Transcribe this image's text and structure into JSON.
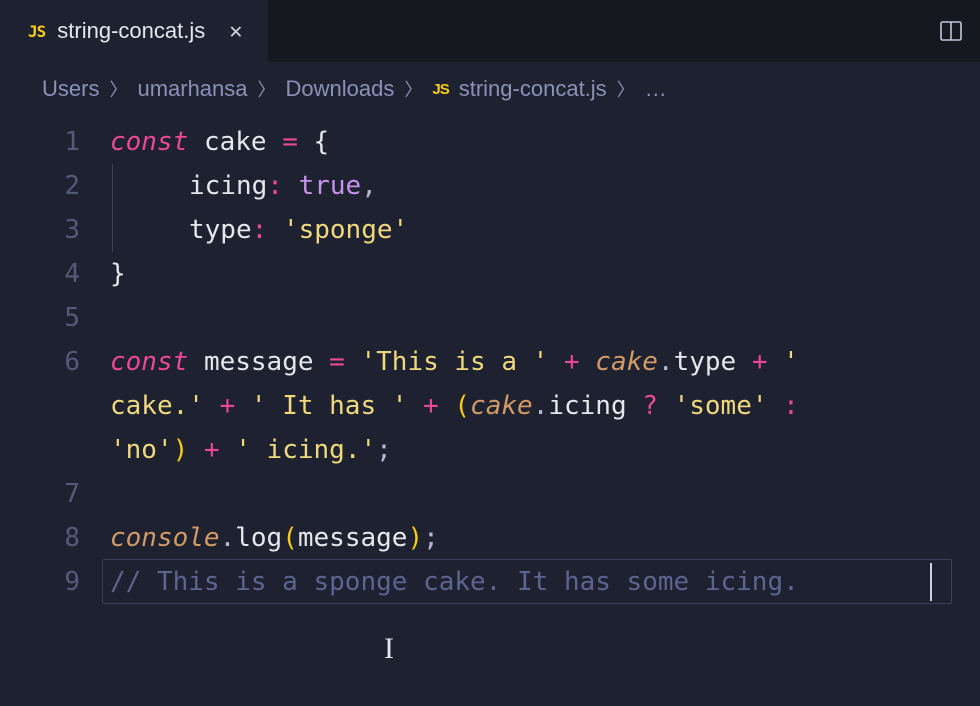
{
  "tab": {
    "lang_badge": "JS",
    "title": "string-concat.js"
  },
  "breadcrumb": {
    "segments": [
      "Users",
      "umarhansa",
      "Downloads"
    ],
    "file_badge": "JS",
    "file": "string-concat.js",
    "ellipsis": "…"
  },
  "gutter": [
    "1",
    "2",
    "3",
    "4",
    "5",
    "6",
    "7",
    "8",
    "9"
  ],
  "code": {
    "l1": {
      "kw": "const",
      "sp1": " ",
      "id": "cake",
      "sp2": " ",
      "eq": "=",
      "sp3": " ",
      "brace": "{"
    },
    "l2": {
      "prop": "icing",
      "colon": ":",
      "sp": " ",
      "val": "true",
      "comma": ","
    },
    "l3": {
      "prop": "type",
      "colon": ":",
      "sp": " ",
      "val": "'sponge'"
    },
    "l4": {
      "brace": "}"
    },
    "l6a": {
      "kw": "const",
      "sp1": " ",
      "id": "message",
      "sp2": " ",
      "eq": "=",
      "sp3": " ",
      "s1": "'This is a '",
      "sp4": " ",
      "plus1": "+",
      "sp5": " ",
      "obj1": "cake",
      "dot1": ".",
      "prop1": "type",
      "sp6": " ",
      "plus2": "+",
      "sp7": " ",
      "s2": "' "
    },
    "l6b": {
      "s3": "cake.'",
      "sp1": " ",
      "plus1": "+",
      "sp2": " ",
      "s4": "' It has '",
      "sp3": " ",
      "plus2": "+",
      "sp4": " ",
      "lp": "(",
      "obj": "cake",
      "dot": ".",
      "prop": "icing",
      "sp5": " ",
      "q": "?",
      "sp6": " ",
      "s5": "'some'",
      "sp7": " ",
      "colon": ":",
      "sp8": " "
    },
    "l6c": {
      "s6": "'no'",
      "rp": ")",
      "sp1": " ",
      "plus": "+",
      "sp2": " ",
      "s7": "' icing.'",
      "semi": ";"
    },
    "l8": {
      "obj": "console",
      "dot": ".",
      "fn": "log",
      "lp": "(",
      "arg": "message",
      "rp": ")",
      "semi": ";"
    },
    "l9": {
      "comment": "// This is a sponge cake. It has some icing."
    }
  }
}
